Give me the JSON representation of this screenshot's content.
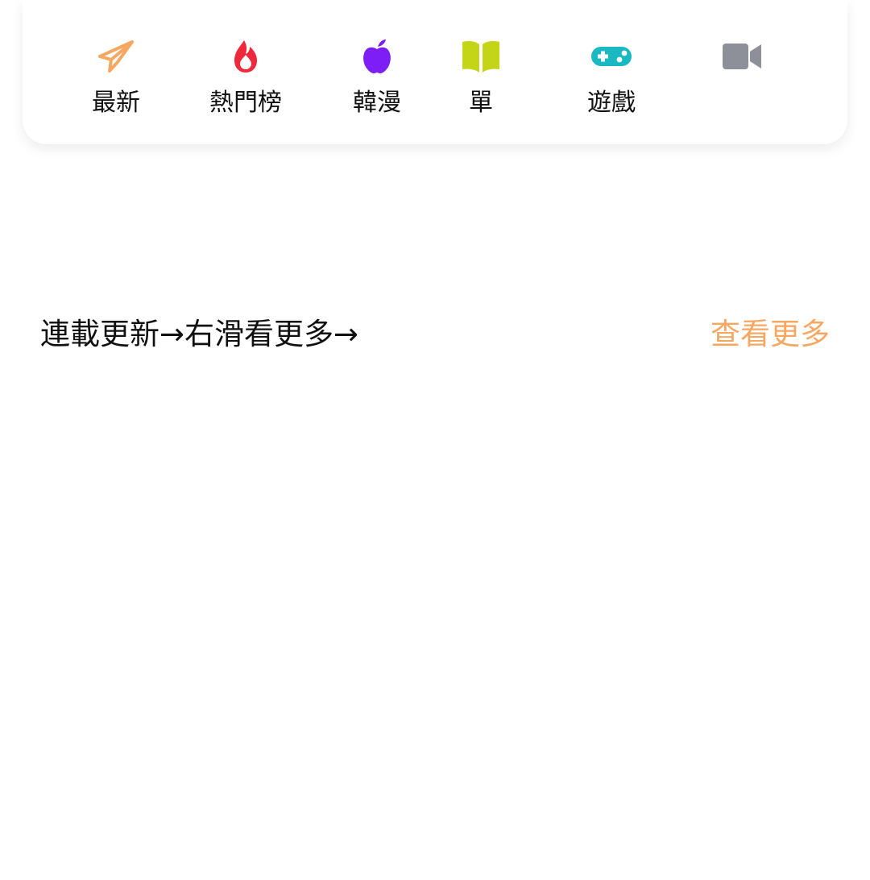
{
  "nav": {
    "items": [
      {
        "label": "最新",
        "icon": "paper-plane-icon",
        "color": "#F6A862"
      },
      {
        "label": "熱門榜",
        "icon": "flame-icon",
        "color": "#F0283C"
      },
      {
        "label": "韓漫",
        "icon": "apple-icon",
        "color": "#7C1EF5"
      },
      {
        "label": "單",
        "icon": "book-icon",
        "color": "#C4D416"
      },
      {
        "label": "遊戲",
        "icon": "gamepad-icon",
        "color": "#1AB8C2"
      },
      {
        "label": "",
        "icon": "video-camera-icon",
        "color": "#8E9099"
      }
    ]
  },
  "section": {
    "title": "連載更新→右滑看更多→",
    "more_label": "查看更多",
    "more_color": "#F6A862"
  }
}
